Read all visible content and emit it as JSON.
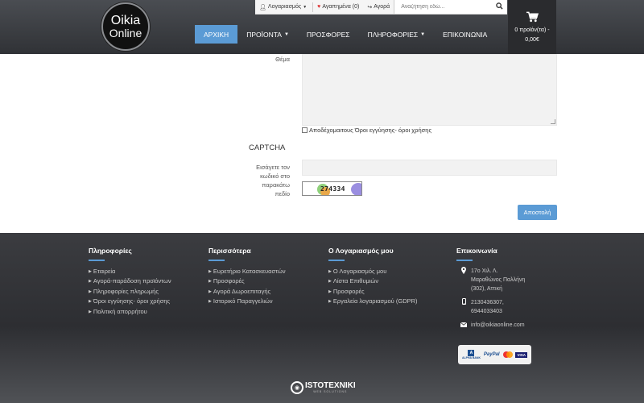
{
  "header": {
    "logo": {
      "line1": "Oikia",
      "line2": "Online"
    },
    "topbar": {
      "account": "Λογαριασμός",
      "wishlist": "Αγαπημένα (0)",
      "checkout": "Αγορά",
      "search_placeholder": "Αναζήτηση εδώ..."
    },
    "nav": [
      "ΑΡΧΙΚΗ",
      "ΠΡΟΪΟΝΤΑ",
      "ΠΡΟΣΦΟΡΕΣ",
      "ΠΛΗΡΟΦΟΡΙΕΣ",
      "ΕΠΙΚΟΙΝΩΝΙΑ"
    ],
    "cart": {
      "line1": "0 προϊόν(τα) -",
      "line2": "0,00€"
    }
  },
  "form": {
    "subject_label": "Θέμα",
    "terms_label": "Αποδέχομαιτους Όροι εγγύησης- όροι χρήσης",
    "captcha_title": "CAPTCHA",
    "captcha_label": [
      "Εισάγετε τον",
      "κωδικό στο",
      "παρακάτω",
      "πεδίο"
    ],
    "captcha_code": "274334",
    "submit_label": "Αποστολή"
  },
  "footer": {
    "info": {
      "title": "Πληροφορίες",
      "items": [
        "Εταιρεία",
        "Αγορά-παράδοση προϊόντων",
        "Πληροφορίες πληρωμής",
        "Όροι εγγύησης- όροι χρήσης",
        "Πολιτική απορρήτου"
      ]
    },
    "more": {
      "title": "Περισσότερα",
      "items": [
        "Ευρετήριο Κατασκευαστών",
        "Προσφορές",
        "Αγορά Δωροεπιταγής",
        "Ιστορικό Παραγγελιών"
      ]
    },
    "account": {
      "title": "Ο Λογαριασμός μου",
      "items": [
        "Ο Λογαριασμός μου",
        "Λίστα Επιθυμιών",
        "Προσφορές",
        "Εργαλεία λογαριασμού (GDPR)"
      ]
    },
    "contact": {
      "title": "Επικοινωνία",
      "address": [
        "17ο Χιλ. Λ.",
        "Μαραθώνος Παλλήνη",
        "(302), Αττική"
      ],
      "phones": [
        "2130436307,",
        "6944033403"
      ],
      "email": "info@oikiaonline.com"
    },
    "payments": {
      "bank": "ALPHA BANK",
      "paypal": "PayPal",
      "visa": "VISA"
    },
    "credit": {
      "name": "ISTOTEXNIKI",
      "sub": "WEB SOLUTIONS"
    }
  }
}
